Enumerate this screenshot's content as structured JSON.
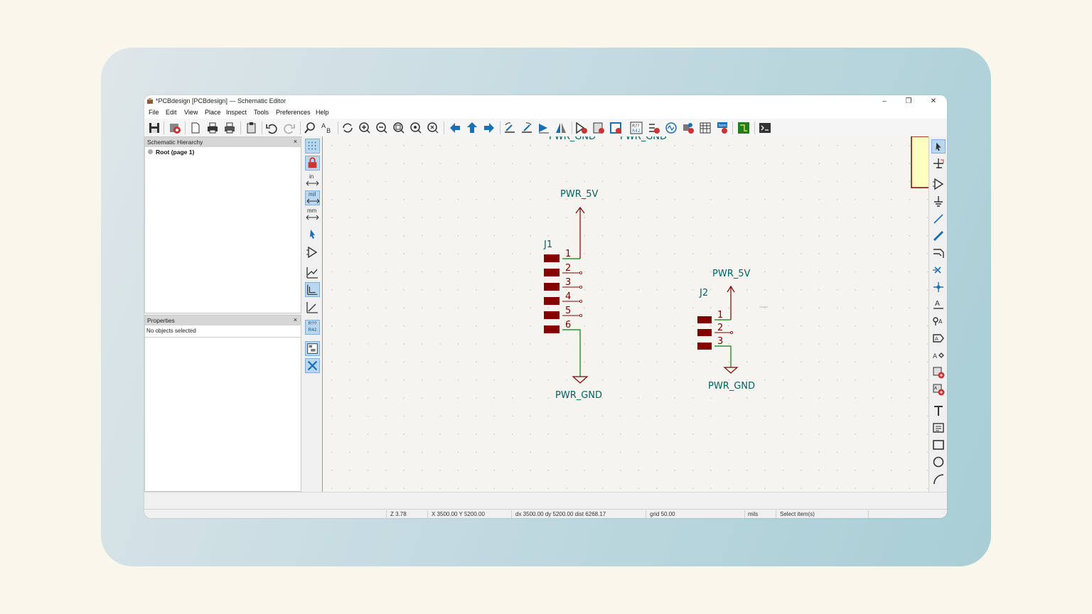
{
  "window": {
    "title": "*PCBdesign [PCBdesign] — Schematic Editor",
    "controls": {
      "minimize": "–",
      "maximize": "❐",
      "close": "✕"
    }
  },
  "menu": [
    "File",
    "Edit",
    "View",
    "Place",
    "Inspect",
    "Tools",
    "Preferences",
    "Help"
  ],
  "panels": {
    "hierarchy": {
      "title": "Schematic Hierarchy",
      "close": "×",
      "root_item": "Root (page 1)"
    },
    "properties": {
      "title": "Properties",
      "close": "×",
      "empty_text": "No objects selected"
    }
  },
  "left_toolbar": {
    "units": {
      "inch": "in",
      "mil": "mil",
      "mm": "mm"
    },
    "annotation": "R?? R42"
  },
  "schematic": {
    "top_labels": [
      "PWR_GND",
      "PWR_GND"
    ],
    "j1": {
      "ref": "J1",
      "power_top": "PWR_5V",
      "power_bottom": "PWR_GND",
      "pins": [
        "1",
        "2",
        "3",
        "4",
        "5",
        "6"
      ]
    },
    "j2": {
      "ref": "J2",
      "power_top": "PWR_5V",
      "power_bottom": "PWR_GND",
      "pins": [
        "1",
        "2",
        "3"
      ]
    }
  },
  "statusbar": {
    "zoom": "Z 3.78",
    "xy": "X 3500.00  Y 5200.00",
    "delta": "dx 3500.00  dy 5200.00  dist 6268.17",
    "grid": "grid 50.00",
    "units": "mils",
    "mode": "Select item(s)"
  },
  "colors": {
    "wire": "#008400",
    "symbol": "#840000",
    "power_text": "#006464",
    "accent": "#1a6fb5"
  }
}
